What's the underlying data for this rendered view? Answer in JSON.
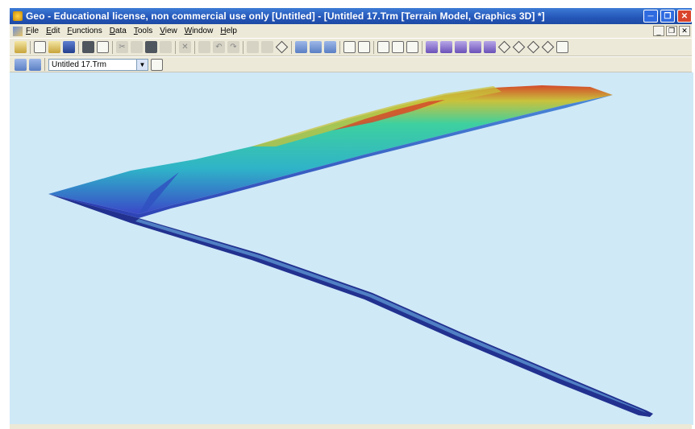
{
  "window": {
    "title": "Geo - Educational license, non commercial use only [Untitled] - [Untitled 17.Trm [Terrain Model, Graphics 3D] *]",
    "controls": [
      "minimize",
      "restore",
      "close"
    ]
  },
  "menubar": {
    "items": [
      "File",
      "Edit",
      "Functions",
      "Data",
      "Tools",
      "View",
      "Window",
      "Help"
    ]
  },
  "toolbar2": {
    "model_select_value": "Untitled 17.Trm"
  },
  "icons": {
    "app": "geo-app-icon",
    "document": "terrain-document-icon"
  },
  "colors": {
    "titlebar": "#2456b8",
    "viewport_background": "#cfe9f7",
    "terrain_low": "#3a48c8",
    "terrain_mid": "#3ed0a0",
    "terrain_high": "#d44a2a"
  }
}
